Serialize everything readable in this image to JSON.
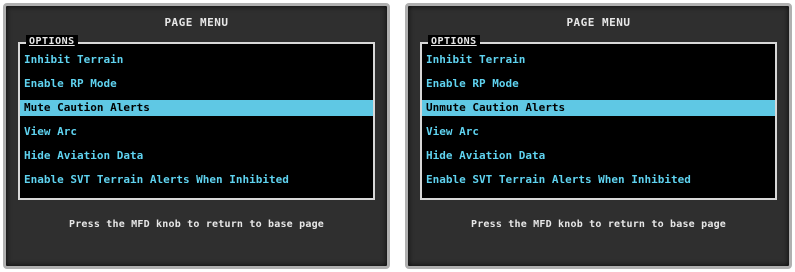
{
  "screens": [
    {
      "title": "PAGE MENU",
      "options_label": "OPTIONS",
      "selected_index": 2,
      "items": [
        "Inhibit Terrain",
        "Enable RP Mode",
        "Mute Caution Alerts",
        "View Arc",
        "Hide Aviation Data",
        "Enable SVT Terrain Alerts When Inhibited"
      ],
      "footer": "Press the MFD knob to return to base page"
    },
    {
      "title": "PAGE MENU",
      "options_label": "OPTIONS",
      "selected_index": 2,
      "items": [
        "Inhibit Terrain",
        "Enable RP Mode",
        "Unmute Caution Alerts",
        "View Arc",
        "Hide Aviation Data",
        "Enable SVT Terrain Alerts When Inhibited"
      ],
      "footer": "Press the MFD knob to return to base page"
    }
  ],
  "colors": {
    "menu_text": "#5fd3f0",
    "highlight": "#5fc8e4",
    "bezel": "#2f2f2f"
  }
}
